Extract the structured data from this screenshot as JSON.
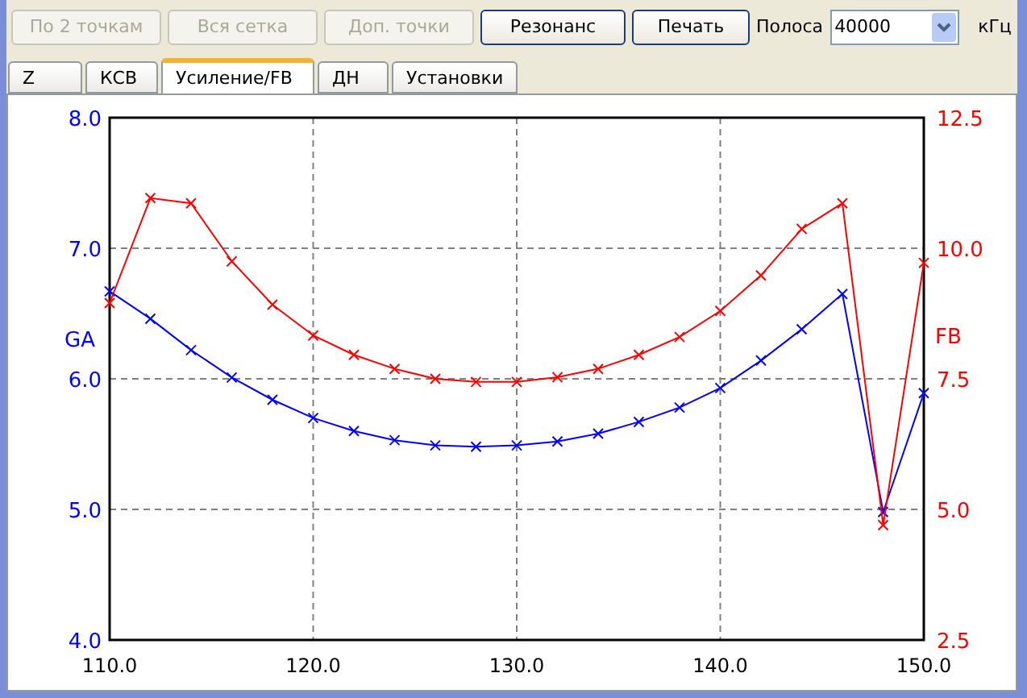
{
  "toolbar": {
    "buttons": [
      {
        "label": "По 2 точкам",
        "disabled": true
      },
      {
        "label": "Вся сетка",
        "disabled": true
      },
      {
        "label": "Доп. точки",
        "disabled": true
      },
      {
        "label": "Резонанс",
        "disabled": false
      },
      {
        "label": "Печать",
        "disabled": false
      }
    ],
    "band_label": "Полоса",
    "band_select": {
      "value": "40000"
    },
    "unit": "кГц"
  },
  "tabs": [
    {
      "label": "Z",
      "selected": false
    },
    {
      "label": "КСВ",
      "selected": false
    },
    {
      "label": "Усиление/FB",
      "selected": true
    },
    {
      "label": "ДН",
      "selected": false
    },
    {
      "label": "Установки",
      "selected": false
    }
  ],
  "chart": {
    "chart_data": {
      "type": "line",
      "grid": true,
      "x": [
        110,
        112,
        114,
        116,
        118,
        120,
        122,
        124,
        126,
        128,
        130,
        132,
        134,
        136,
        138,
        140,
        142,
        144,
        146,
        148,
        150
      ],
      "xlim": [
        110,
        150
      ],
      "ylim": [
        4,
        8
      ],
      "y2lim": [
        2.5,
        12.5
      ],
      "xticks": [
        {
          "value": 110,
          "label": "110.0"
        },
        {
          "value": 120,
          "label": "120.0"
        },
        {
          "value": 130,
          "label": "130.0"
        },
        {
          "value": 140,
          "label": "140.0"
        },
        {
          "value": 150,
          "label": "150.0"
        }
      ],
      "yticks": [
        {
          "value": 4,
          "label": "4.0"
        },
        {
          "value": 5,
          "label": "5.0"
        },
        {
          "value": 6,
          "label": "6.0"
        },
        {
          "value": 7,
          "label": "7.0"
        },
        {
          "value": 8,
          "label": "8.0"
        }
      ],
      "y2ticks": [
        {
          "value": 2.5,
          "label": "2.5"
        },
        {
          "value": 5,
          "label": "5.0"
        },
        {
          "value": 7.5,
          "label": "7.5"
        },
        {
          "value": 10,
          "label": "10.0"
        },
        {
          "value": 12.5,
          "label": "12.5"
        }
      ],
      "series": [
        {
          "name": "GA",
          "color": "#0000ff",
          "marker": "x",
          "values": [
            6.67,
            6.46,
            6.22,
            6.01,
            5.84,
            5.7,
            5.6,
            5.53,
            5.49,
            5.48,
            5.49,
            5.52,
            5.58,
            5.67,
            5.78,
            5.93,
            6.14,
            6.38,
            6.65,
            4.98,
            5.89
          ]
        },
        {
          "name": "FB",
          "color": "#ff0000",
          "axis": "y2",
          "marker": "x",
          "values": [
            8.95,
            10.96,
            10.86,
            9.75,
            8.92,
            8.33,
            7.96,
            7.69,
            7.5,
            7.44,
            7.44,
            7.53,
            7.69,
            7.96,
            8.3,
            8.8,
            9.48,
            10.37,
            10.86,
            4.7,
            9.72
          ]
        }
      ]
    }
  }
}
